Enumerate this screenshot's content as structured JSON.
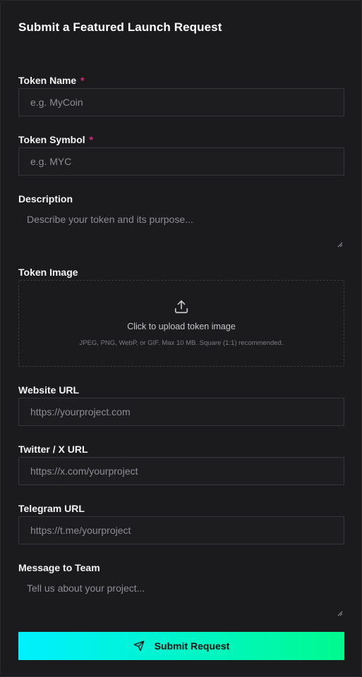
{
  "form": {
    "title": "Submit a Featured Launch Request",
    "required_marker": "*",
    "token_name": {
      "label": "Token Name",
      "placeholder": "e.g. MyCoin",
      "value": ""
    },
    "token_symbol": {
      "label": "Token Symbol",
      "placeholder": "e.g. MYC",
      "value": ""
    },
    "description": {
      "label": "Description",
      "placeholder": "Describe your token and its purpose...",
      "value": ""
    },
    "token_image": {
      "label": "Token Image",
      "upload_text": "Click to upload token image",
      "hint": "JPEG, PNG, WebP, or GIF. Max 10 MB. Square (1:1) recommended.",
      "icon": "upload-icon"
    },
    "website_url": {
      "label": "Website URL",
      "placeholder": "https://yourproject.com",
      "value": ""
    },
    "twitter_url": {
      "label": "Twitter / X URL",
      "placeholder": "https://x.com/yourproject",
      "value": ""
    },
    "telegram_url": {
      "label": "Telegram URL",
      "placeholder": "https://t.me/yourproject",
      "value": ""
    },
    "message": {
      "label": "Message to Team",
      "placeholder": "Tell us about your project...",
      "value": ""
    },
    "submit": {
      "label": "Submit Request",
      "icon": "send-icon"
    }
  },
  "colors": {
    "background": "#1b1b1d",
    "required": "#e0267d",
    "button_gradient_start": "#00f0ff",
    "button_gradient_end": "#00fa8e"
  }
}
